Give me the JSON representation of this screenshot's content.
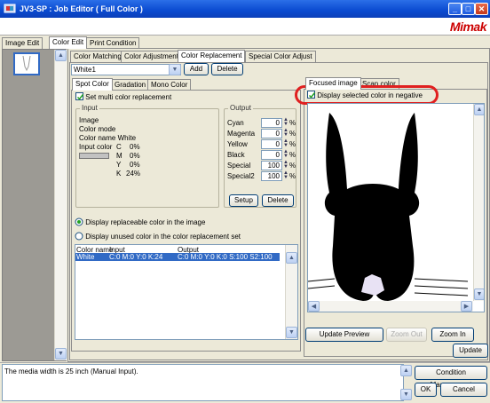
{
  "window": {
    "title": "JV3-SP : Job Editor ( Full Color )",
    "logo": "Mimak"
  },
  "main_tabs": [
    "Image Edit",
    "Color Edit",
    "Print Condition"
  ],
  "sub_tabs": [
    "Color Matching",
    "Color Adjustment",
    "Color Replacement",
    "Special Color Adjust"
  ],
  "replacement": {
    "selected": "White1",
    "add_label": "Add",
    "delete_label": "Delete"
  },
  "inner_tabs": [
    "Spot Color",
    "Gradation",
    "Mono Color"
  ],
  "multi_color": {
    "label": "Set multi color replacement",
    "checked": true
  },
  "input_group": {
    "title": "Input",
    "image": "Image",
    "color_mode": "Color mode",
    "color_name": "Color name White",
    "input_color_label": "Input color",
    "c": "C",
    "c_val": "0%",
    "m": "M",
    "m_val": "0%",
    "y": "Y",
    "y_val": "0%",
    "k": "K",
    "k_val": "24%"
  },
  "output_group": {
    "title": "Output",
    "rows": [
      {
        "label": "Cyan",
        "value": "0",
        "unit": "%"
      },
      {
        "label": "Magenta",
        "value": "0",
        "unit": "%"
      },
      {
        "label": "Yellow",
        "value": "0",
        "unit": "%"
      },
      {
        "label": "Black",
        "value": "0",
        "unit": "%"
      },
      {
        "label": "Special",
        "value": "100",
        "unit": "%"
      },
      {
        "label": "Special2",
        "value": "100",
        "unit": "%"
      }
    ],
    "setup_label": "Setup",
    "delete_label": "Delete"
  },
  "radio": {
    "opt1": "Display replaceable color in the image",
    "opt2": "Display unused color in the color replacement set"
  },
  "table": {
    "headers": [
      "Color name",
      "Input",
      "Output"
    ],
    "row": {
      "name": "White",
      "input": "C:0 M:0 Y:0 K:24",
      "output": "C:0 M:0 Y:0 K:0 S:100 S2:100"
    }
  },
  "preview_tabs": [
    "Focused image",
    "Scan color"
  ],
  "negative": {
    "label": "Display selected color in negative",
    "checked": true
  },
  "preview_buttons": {
    "update_preview": "Update Preview",
    "zoom_out": "Zoom Out",
    "zoom_in": "Zoom In",
    "update": "Update"
  },
  "status": {
    "message": "The media width is 25 inch (Manual Input).",
    "condition": "Condition Management",
    "ok": "OK",
    "cancel": "Cancel"
  },
  "colors": {
    "title_blue": "#0a4ad0",
    "highlight_red": "#e02020",
    "selection": "#316ac5",
    "logo_red": "#cc0000"
  }
}
